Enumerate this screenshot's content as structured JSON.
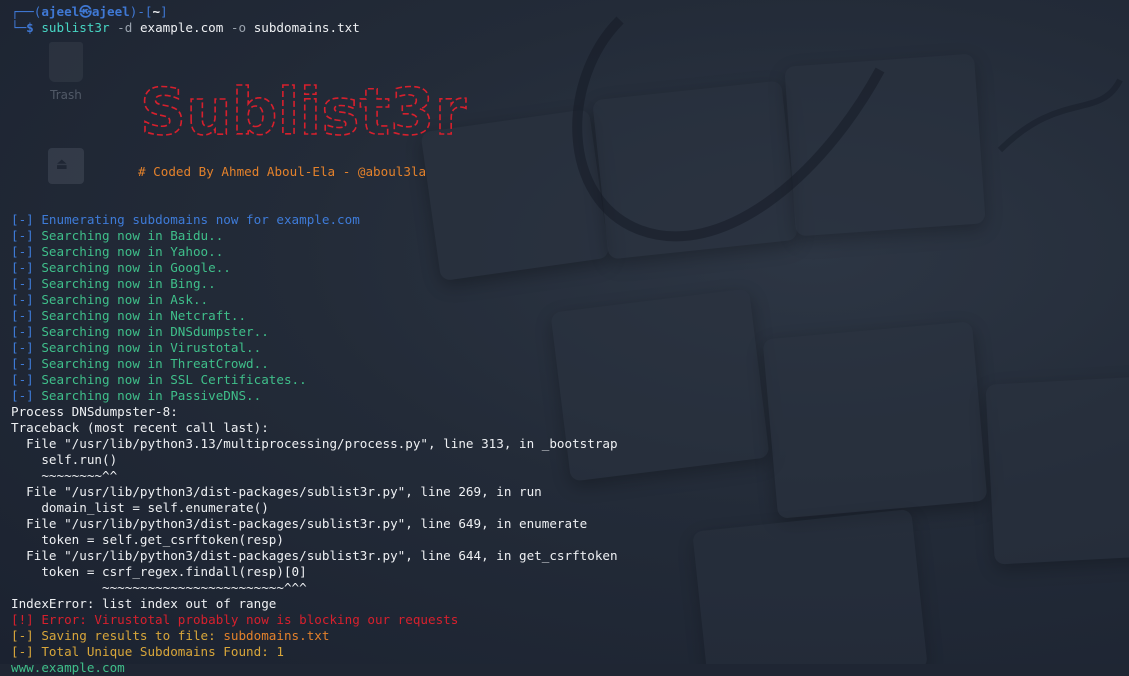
{
  "desktop": {
    "trash_label": "Trash"
  },
  "prompt": {
    "open": "┌──(",
    "user": "ajeel㉿ajeel",
    "mid": ")-[",
    "dir": "~",
    "close": "]",
    "arrow": "└─$ ",
    "command": "sublist3r",
    "args": [
      " -d ",
      "example.com",
      " -o ",
      "subdomains.txt"
    ]
  },
  "banner": {
    "logo_text": "Sublist3r",
    "coded_by": "# Coded By Ahmed Aboul-Ela - @aboul3la"
  },
  "output": {
    "enumerating": {
      "tag": "[-]",
      "text": " Enumerating subdomains now for example.com"
    },
    "searches": [
      {
        "tag": "[-]",
        "text": " Searching now in Baidu.."
      },
      {
        "tag": "[-]",
        "text": " Searching now in Yahoo.."
      },
      {
        "tag": "[-]",
        "text": " Searching now in Google.."
      },
      {
        "tag": "[-]",
        "text": " Searching now in Bing.."
      },
      {
        "tag": "[-]",
        "text": " Searching now in Ask.."
      },
      {
        "tag": "[-]",
        "text": " Searching now in Netcraft.."
      },
      {
        "tag": "[-]",
        "text": " Searching now in DNSdumpster.."
      },
      {
        "tag": "[-]",
        "text": " Searching now in Virustotal.."
      },
      {
        "tag": "[-]",
        "text": " Searching now in ThreatCrowd.."
      },
      {
        "tag": "[-]",
        "text": " Searching now in SSL Certificates.."
      },
      {
        "tag": "[-]",
        "text": " Searching now in PassiveDNS.."
      }
    ],
    "traceback": [
      "Process DNSdumpster-8:",
      "Traceback (most recent call last):",
      "  File \"/usr/lib/python3.13/multiprocessing/process.py\", line 313, in _bootstrap",
      "    self.run()",
      "    ~~~~~~~~^^",
      "  File \"/usr/lib/python3/dist-packages/sublist3r.py\", line 269, in run",
      "    domain_list = self.enumerate()",
      "  File \"/usr/lib/python3/dist-packages/sublist3r.py\", line 649, in enumerate",
      "    token = self.get_csrftoken(resp)",
      "  File \"/usr/lib/python3/dist-packages/sublist3r.py\", line 644, in get_csrftoken",
      "    token = csrf_regex.findall(resp)[0]",
      "            ~~~~~~~~~~~~~~~~~~~~~~~~^^^",
      "IndexError: list index out of range"
    ],
    "error_line": "[!] Error: Virustotal probably now is blocking our requests",
    "saving": {
      "tag": "[-] Saving results to file: ",
      "file": "subdomains.txt"
    },
    "total": "[-] Total Unique Subdomains Found: 1",
    "result": "www.example.com"
  },
  "colors": {
    "background": "#1f2633",
    "prompt_blue": "#3f78d4",
    "command_cyan": "#47d6c4",
    "status_green": "#3fbf8a",
    "error_red": "#d7202d",
    "banner_red": "#d7202d",
    "orange": "#e3812b"
  }
}
